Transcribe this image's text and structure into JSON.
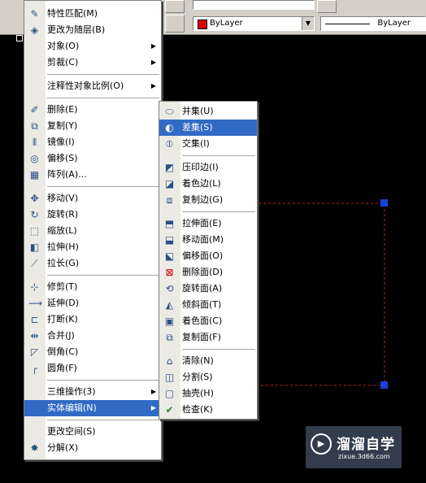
{
  "colors": {
    "highlight": "#316ac5",
    "selection_grip": "#1a40d8",
    "dashed_line": "#c02020",
    "layer_swatch": "#e00000"
  },
  "toolbar": {
    "color_combo": {
      "value": "ByLayer"
    },
    "linetype_combo": {
      "value": "ByLayer"
    }
  },
  "modify_menu": {
    "items": [
      {
        "label": "特性匹配(M)",
        "icon": "match-properties-icon",
        "submenu": false
      },
      {
        "label": "更改为随层(B)",
        "icon": "set-bylayer-icon",
        "submenu": false
      },
      {
        "label": "对象(O)",
        "icon": "",
        "submenu": true
      },
      {
        "label": "剪裁(C)",
        "icon": "",
        "submenu": true
      },
      {
        "label": "注释性对象比例(O)",
        "icon": "",
        "submenu": true
      },
      {
        "label": "删除(E)",
        "icon": "erase-icon",
        "submenu": false
      },
      {
        "label": "复制(Y)",
        "icon": "copy-icon",
        "submenu": false
      },
      {
        "label": "镜像(I)",
        "icon": "mirror-icon",
        "submenu": false
      },
      {
        "label": "偏移(S)",
        "icon": "offset-icon",
        "submenu": false
      },
      {
        "label": "阵列(A)...",
        "icon": "array-icon",
        "submenu": false
      },
      {
        "label": "移动(V)",
        "icon": "move-icon",
        "submenu": false
      },
      {
        "label": "旋转(R)",
        "icon": "rotate-icon",
        "submenu": false
      },
      {
        "label": "缩放(L)",
        "icon": "scale-icon",
        "submenu": false
      },
      {
        "label": "拉伸(H)",
        "icon": "stretch-icon",
        "submenu": false
      },
      {
        "label": "拉长(G)",
        "icon": "lengthen-icon",
        "submenu": false
      },
      {
        "label": "修剪(T)",
        "icon": "trim-icon",
        "submenu": false
      },
      {
        "label": "延伸(D)",
        "icon": "extend-icon",
        "submenu": false
      },
      {
        "label": "打断(K)",
        "icon": "break-icon",
        "submenu": false
      },
      {
        "label": "合并(J)",
        "icon": "join-icon",
        "submenu": false
      },
      {
        "label": "倒角(C)",
        "icon": "chamfer-icon",
        "submenu": false
      },
      {
        "label": "圆角(F)",
        "icon": "fillet-icon",
        "submenu": false
      },
      {
        "label": "三维操作(3)",
        "icon": "",
        "submenu": true
      },
      {
        "label": "实体编辑(N)",
        "icon": "",
        "submenu": true
      },
      {
        "label": "更改空间(S)",
        "icon": "",
        "submenu": false
      },
      {
        "label": "分解(X)",
        "icon": "explode-icon",
        "submenu": false
      }
    ]
  },
  "solid_edit_menu": {
    "items": [
      {
        "label": "并集(U)",
        "icon": "union-icon"
      },
      {
        "label": "差集(S)",
        "icon": "subtract-icon"
      },
      {
        "label": "交集(I)",
        "icon": "intersect-icon"
      },
      {
        "label": "压印边(I)",
        "icon": "imprint-edges-icon"
      },
      {
        "label": "着色边(L)",
        "icon": "color-edges-icon"
      },
      {
        "label": "复制边(G)",
        "icon": "copy-edges-icon"
      },
      {
        "label": "拉伸面(E)",
        "icon": "extrude-faces-icon"
      },
      {
        "label": "移动面(M)",
        "icon": "move-faces-icon"
      },
      {
        "label": "偏移面(O)",
        "icon": "offset-faces-icon"
      },
      {
        "label": "删除面(D)",
        "icon": "delete-faces-icon"
      },
      {
        "label": "旋转面(A)",
        "icon": "rotate-faces-icon"
      },
      {
        "label": "倾斜面(T)",
        "icon": "taper-faces-icon"
      },
      {
        "label": "着色面(C)",
        "icon": "color-faces-icon"
      },
      {
        "label": "复制面(F)",
        "icon": "copy-faces-icon"
      },
      {
        "label": "清除(N)",
        "icon": "clean-icon"
      },
      {
        "label": "分割(S)",
        "icon": "separate-icon"
      },
      {
        "label": "抽壳(H)",
        "icon": "shell-icon"
      },
      {
        "label": "检查(K)",
        "icon": "check-icon"
      }
    ]
  },
  "watermark": {
    "brand": "溜溜自学",
    "url": "zixue.3d66.com"
  }
}
